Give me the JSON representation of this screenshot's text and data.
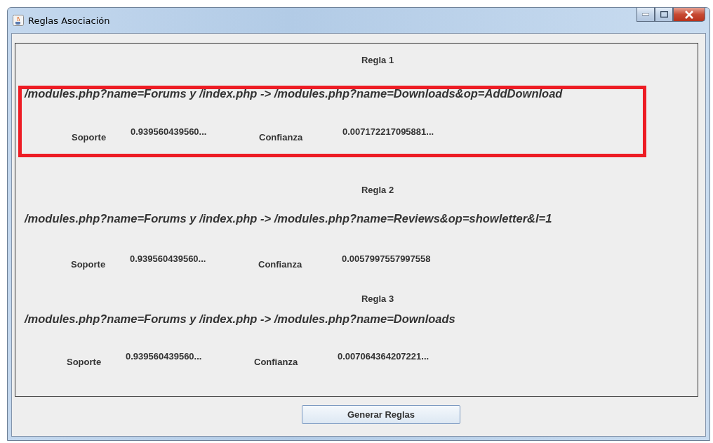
{
  "window": {
    "title": "Reglas Asociación"
  },
  "rules": [
    {
      "title": "Regla 1",
      "expression": "/modules.php?name=Forums y /index.php -> /modules.php?name=Downloads&op=AddDownload",
      "support_label": "Soporte",
      "support": "0.939560439560...",
      "confidence_label": "Confianza",
      "confidence": "0.007172217095881...",
      "highlighted": true
    },
    {
      "title": "Regla 2",
      "expression": "/modules.php?name=Forums y /index.php -> /modules.php?name=Reviews&op=showletter&l=1",
      "support_label": "Soporte",
      "support": "0.939560439560...",
      "confidence_label": "Confianza",
      "confidence": "0.0057997557997558",
      "highlighted": false
    },
    {
      "title": "Regla 3",
      "expression": "/modules.php?name=Forums y /index.php -> /modules.php?name=Downloads",
      "support_label": "Soporte",
      "support": "0.939560439560...",
      "confidence_label": "Confianza",
      "confidence": "0.007064364207221...",
      "highlighted": false
    }
  ],
  "button": "Generar Reglas"
}
